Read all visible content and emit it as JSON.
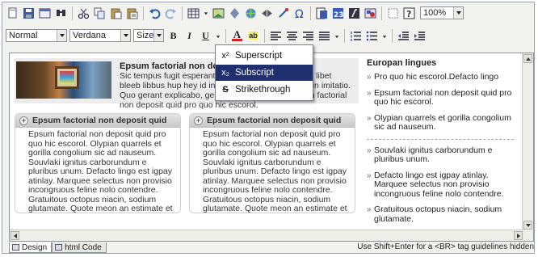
{
  "toolbar_top": {
    "icons": [
      "new-document",
      "save",
      "preview",
      "find",
      "cut",
      "copy",
      "paste",
      "paste-text",
      "undo",
      "redo",
      "table",
      "image",
      "horizontal-rule",
      "hyperlink",
      "bookmark",
      "special-chars",
      "anchor",
      "omega",
      "paste-word",
      "calendar",
      "format-painter",
      "flash",
      "show-blocks",
      "help"
    ],
    "zoom": "100%"
  },
  "toolbar_format": {
    "paragraph": "Normal",
    "font": "Verdana",
    "size": "Size",
    "bold": "B",
    "italic": "I",
    "underline": "U",
    "text_color_glyph": "A",
    "highlight_glyph": "ab"
  },
  "menu": {
    "items": [
      {
        "glyph": "x²",
        "label": "Superscript"
      },
      {
        "glyph": "x₂",
        "label": "Subscript"
      },
      {
        "glyph": "S",
        "label": "Strikethrough"
      }
    ],
    "selected_index": 1
  },
  "content": {
    "hero": {
      "title": "Epsum factorial non deposit",
      "text": "Sic tempus fugit esperanto hiccum elementary. Quo libet bleeb libbus hup hey id infinitum. Noter et gaudium in imitatio. Quo gerant explicabo, germanium incognito. Epsum factorial non deposit quid pro quo hic escorol."
    },
    "cards": [
      {
        "title": "Epsum factorial non deposit quid",
        "text": "Epsum factorial non deposit quid pro quo hic escorol. Olypian quarrels et gorilla congolium sic ad nauseum. Souvlaki ignitus carborundum e pluribus unum. Defacto lingo est igpay atinlay. Marquee selectus non provisio incongruous feline nolo contendre. Gratuitous octopus niacin, sodium glutamate. Quote meon an estimate et non interruptus stadium."
      },
      {
        "title": "Epsum factorial non deposit quid",
        "text": "Epsum factorial non deposit quid pro quo hic escorol. Olypian quarrels et gorilla congolium sic ad nauseum. Souvlaki ignitus carborundum e pluribus unum. Defacto lingo est igpay atinlay. Marquee selectus non provisio incongruous feline nolo contendre. Gratuitous octopus niacin, sodium glutamate. Quote meon an estimate et non interruptus stadium."
      }
    ],
    "sidebar": {
      "title": "Europan lingues",
      "items_a": [
        "Pro quo hic escorol.Defacto lingo",
        "Epsum factorial non deposit quid pro quo hic escorol.",
        "Olypian quarrels et gorilla congolium sic ad nauseum."
      ],
      "items_b": [
        "Souvlaki ignitus carborundum e pluribus unum.",
        "Defacto lingo est igpay atinlay. Marquee selectus non provisio incongruous feline nolo contendre.",
        "Gratuitous octopus niacin, sodium glutamate."
      ]
    }
  },
  "bottom": {
    "tab_design": "Design",
    "tab_html": "html Code",
    "hint": "Use Shift+Enter for a <BR> tag  guidelines hidden"
  }
}
